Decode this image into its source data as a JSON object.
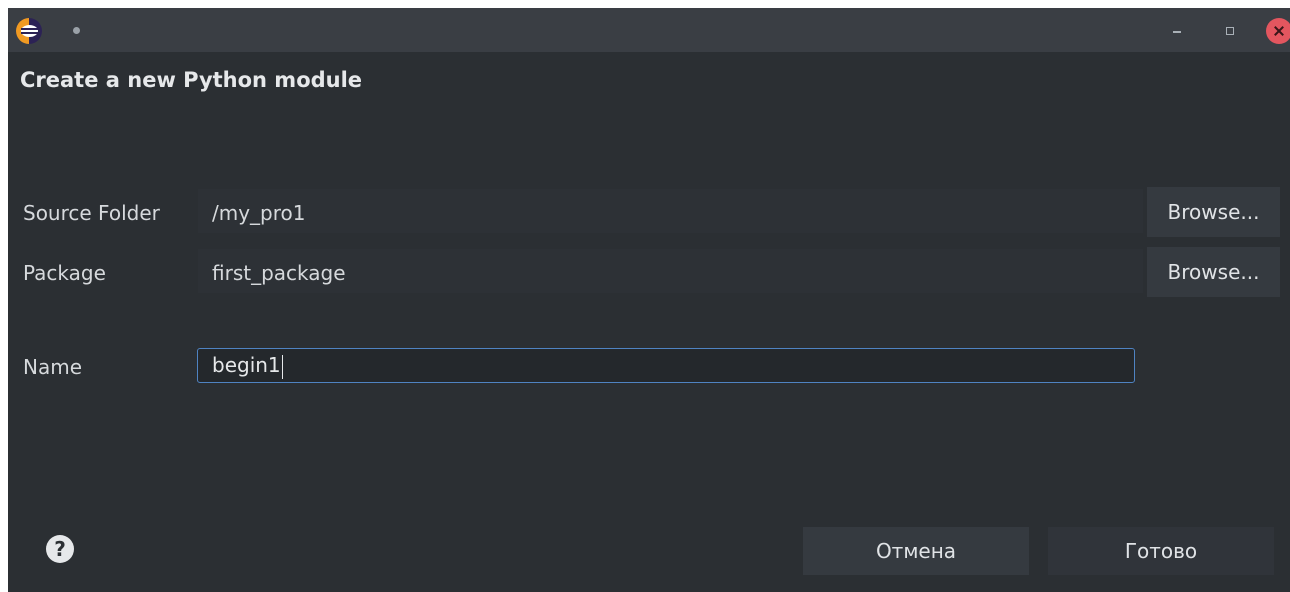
{
  "dialog": {
    "heading": "Create a new Python module"
  },
  "form": {
    "source_folder": {
      "label": "Source Folder",
      "value": "/my_pro1",
      "browse_label": "Browse..."
    },
    "package": {
      "label": "Package",
      "value": "first_package",
      "browse_label": "Browse..."
    },
    "name": {
      "label": "Name",
      "value": "begin1"
    }
  },
  "footer": {
    "help_glyph": "?",
    "cancel_label": "Отмена",
    "finish_label": "Готово"
  },
  "icons": {
    "app": "eclipse-icon",
    "minimize": "minimize-icon",
    "maximize": "maximize-icon",
    "close": "close-icon",
    "help": "help-icon"
  },
  "colors": {
    "background": "#2b2f33",
    "titlebar": "#3a3e44",
    "focus_border": "#4f83c2",
    "close_button": "#e3565f"
  }
}
